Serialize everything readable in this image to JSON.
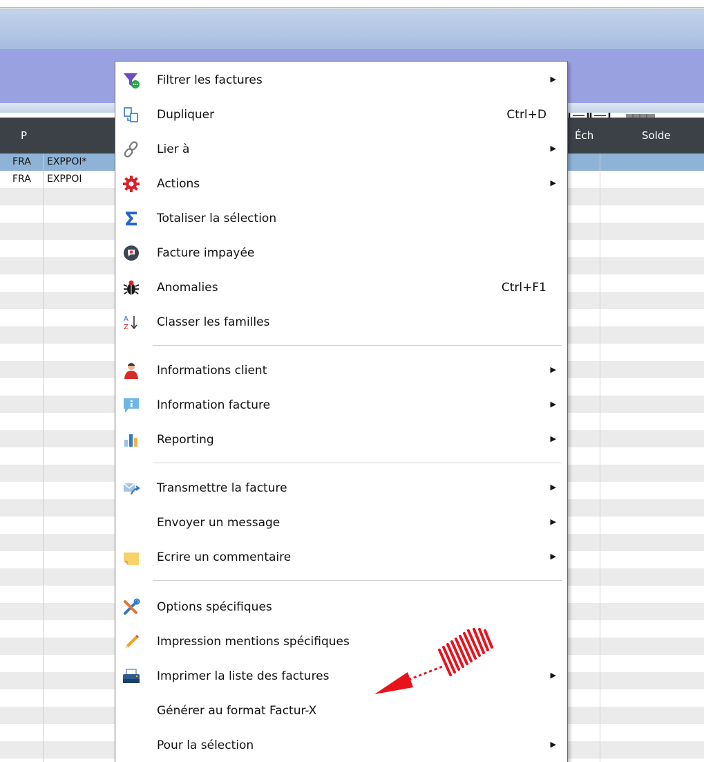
{
  "grid": {
    "columns": {
      "p": "P",
      "ech": "Éch",
      "solde": "Solde"
    },
    "rows": [
      {
        "c1": "FRA",
        "c2": "EXPPOI*"
      },
      {
        "c1": "FRA",
        "c2": "EXPPOI"
      }
    ]
  },
  "menu": {
    "filtrer": {
      "label": "Filtrer les factures"
    },
    "dupliquer": {
      "label": "Dupliquer",
      "shortcut": "Ctrl+D"
    },
    "lier": {
      "label": "Lier à"
    },
    "actions": {
      "label": "Actions"
    },
    "totaliser": {
      "label": "Totaliser la sélection"
    },
    "impayee": {
      "label": "Facture impayée"
    },
    "anomalies": {
      "label": "Anomalies",
      "shortcut": "Ctrl+F1"
    },
    "classer": {
      "label": "Classer les familles",
      "icon_text_a": "A",
      "icon_text_z": "Z"
    },
    "info_client": {
      "label": "Informations client"
    },
    "info_facture": {
      "label": "Information facture"
    },
    "reporting": {
      "label": "Reporting"
    },
    "transmettre": {
      "label": "Transmettre la facture"
    },
    "envoyer": {
      "label": "Envoyer un message"
    },
    "ecrire": {
      "label": "Ecrire un commentaire"
    },
    "options": {
      "label": "Options spécifiques"
    },
    "impression": {
      "label": "Impression mentions spécifiques"
    },
    "imprimer": {
      "label": "Imprimer la liste des factures"
    },
    "generer": {
      "label": "Générer au format Factur-X"
    },
    "pour_selection": {
      "label": "Pour la sélection"
    }
  },
  "colors": {
    "toolbar": "#9aa1e0",
    "header": "#3c4147",
    "selected_row": "#8fb3d6",
    "pointer_arrow": "#e8121b"
  }
}
